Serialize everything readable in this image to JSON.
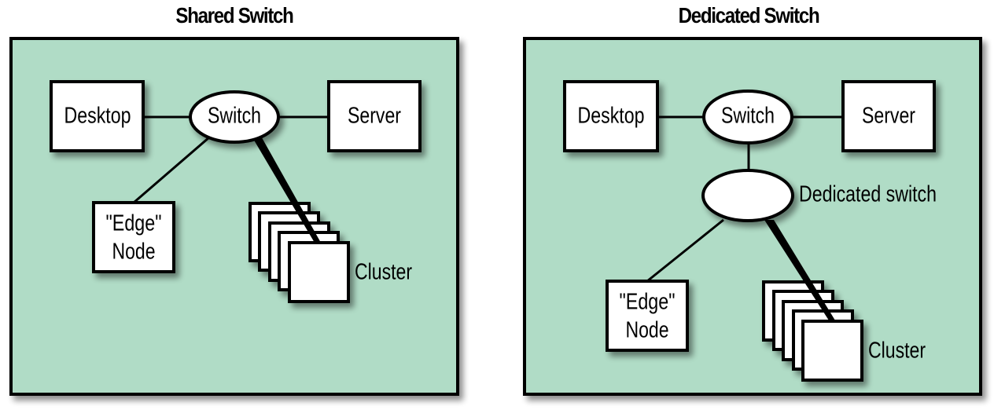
{
  "panels": [
    {
      "title": "Shared Switch",
      "nodes": {
        "desktop": "Desktop",
        "switch": "Switch",
        "server": "Server",
        "edge_line1": "\"Edge\"",
        "edge_line2": "Node",
        "cluster": "Cluster"
      }
    },
    {
      "title": "Dedicated Switch",
      "nodes": {
        "desktop": "Desktop",
        "switch": "Switch",
        "server": "Server",
        "dedicated_switch": "Dedicated switch",
        "edge_line1": "\"Edge\"",
        "edge_line2": "Node",
        "cluster": "Cluster"
      }
    }
  ],
  "colors": {
    "panel_fill": "#b0dcc6",
    "stroke": "#000000",
    "node_fill": "#ffffff"
  }
}
